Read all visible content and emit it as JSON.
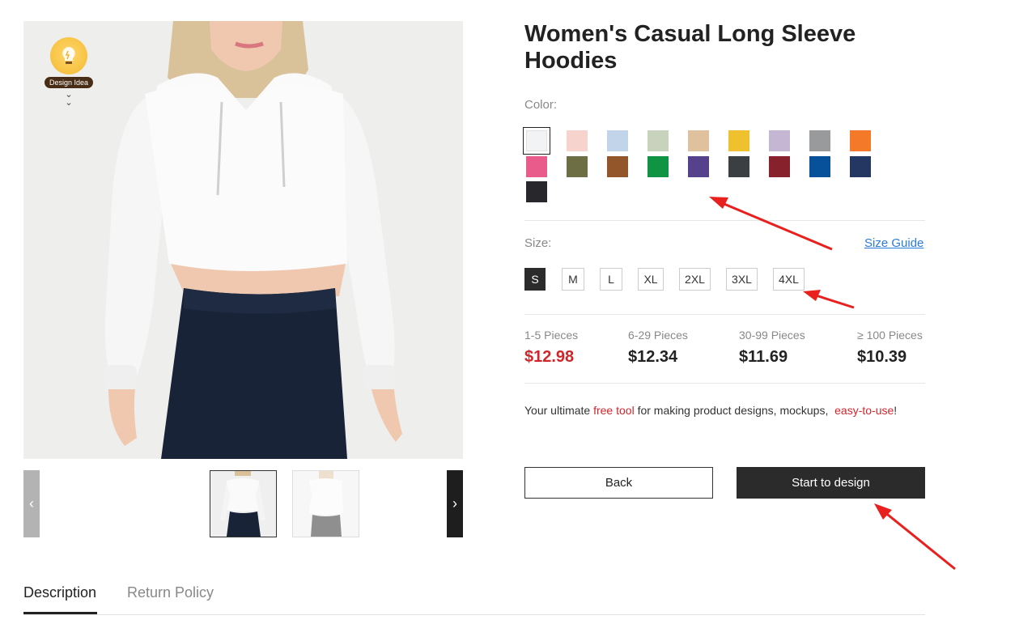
{
  "product": {
    "title": "Women's Casual Long Sleeve Hoodies"
  },
  "gallery": {
    "design_idea_label": "Design Idea",
    "prev_icon": "chevron-left-icon",
    "next_icon": "chevron-right-icon"
  },
  "color": {
    "label": "Color:",
    "swatches": [
      {
        "name": "white",
        "hex": "#f2f3f5",
        "selected": true
      },
      {
        "name": "light-pink",
        "hex": "#f6d3cc"
      },
      {
        "name": "light-blue",
        "hex": "#c1d4ea"
      },
      {
        "name": "sage",
        "hex": "#c8d3bd"
      },
      {
        "name": "tan",
        "hex": "#e0c19d"
      },
      {
        "name": "gold",
        "hex": "#f0c12e"
      },
      {
        "name": "lavender",
        "hex": "#c5b6d3"
      },
      {
        "name": "grey",
        "hex": "#999a9c"
      },
      {
        "name": "orange",
        "hex": "#f47a2a"
      },
      {
        "name": "pink",
        "hex": "#e85b8a"
      },
      {
        "name": "olive",
        "hex": "#6e6e45"
      },
      {
        "name": "brown",
        "hex": "#93552a"
      },
      {
        "name": "green",
        "hex": "#0f9444"
      },
      {
        "name": "purple",
        "hex": "#56418c"
      },
      {
        "name": "charcoal",
        "hex": "#3c3f42"
      },
      {
        "name": "maroon",
        "hex": "#87212c"
      },
      {
        "name": "royal",
        "hex": "#06519a"
      },
      {
        "name": "navy",
        "hex": "#243763"
      },
      {
        "name": "black",
        "hex": "#28282c"
      }
    ]
  },
  "size": {
    "label": "Size:",
    "guide_link": "Size Guide",
    "options": [
      "S",
      "M",
      "L",
      "XL",
      "2XL",
      "3XL",
      "4XL"
    ],
    "selected": "S"
  },
  "pricing": {
    "tiers": [
      {
        "qty": "1-5 Pieces",
        "price": "$12.98"
      },
      {
        "qty": "6-29 Pieces",
        "price": "$12.34"
      },
      {
        "qty": "30-99 Pieces",
        "price": "$11.69"
      },
      {
        "qty": "≥ 100 Pieces",
        "price": "$10.39"
      }
    ]
  },
  "tagline": {
    "part1": "Your ultimate ",
    "highlight1": "free tool",
    "part2": " for making product designs, mockups,  ",
    "highlight2": "easy-to-use",
    "part3": "!"
  },
  "actions": {
    "back": "Back",
    "start": "Start to design"
  },
  "tabs": [
    {
      "label": "Description",
      "active": true
    },
    {
      "label": "Return Policy",
      "active": false
    }
  ],
  "colors": {
    "accent_red": "#d0262b",
    "link_blue": "#2b7bd9",
    "dark_button": "#2b2b2b",
    "arrow_red": "#e8201e"
  }
}
